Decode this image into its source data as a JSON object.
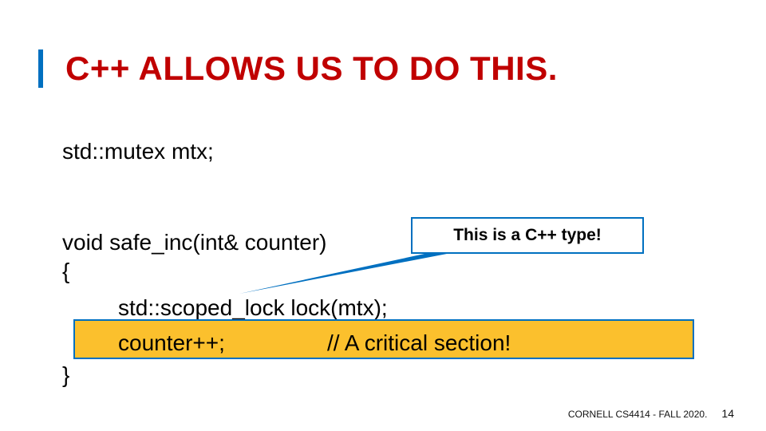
{
  "title": "C++ ALLOWS US TO DO THIS.",
  "code": {
    "line1": "std::mutex mtx;",
    "line2": "void safe_inc(int& counter)",
    "brace_open": "{",
    "line3": "std::scoped_lock  lock(mtx);",
    "line4_left": "counter++;",
    "line4_right": "// A critical section!",
    "brace_close": "}"
  },
  "callout": "This is a C++ type!",
  "footer": {
    "course": "CORNELL CS4414 - FALL 2020.",
    "page": "14"
  }
}
